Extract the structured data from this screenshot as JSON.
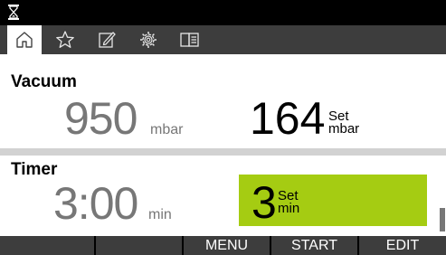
{
  "status_bar": {
    "icon": "hourglass-icon"
  },
  "tabs": [
    {
      "icon": "home-icon",
      "active": true
    },
    {
      "icon": "star-icon",
      "active": false
    },
    {
      "icon": "edit-icon",
      "active": false
    },
    {
      "icon": "gear-icon",
      "active": false
    },
    {
      "icon": "book-icon",
      "active": false
    }
  ],
  "vacuum": {
    "title": "Vacuum",
    "actual_value": "950",
    "actual_unit": "mbar",
    "set_value": "164",
    "set_label": "Set",
    "set_unit": "mbar"
  },
  "timer": {
    "title": "Timer",
    "actual_value": "3:00",
    "actual_unit": "min",
    "set_value": "3",
    "set_label": "Set",
    "set_unit": "min"
  },
  "softkeys": [
    "",
    "",
    "MENU",
    "START",
    "EDIT"
  ],
  "colors": {
    "highlight": "#a5cc12",
    "bar": "#3d3d3d",
    "value_gray": "#777777"
  }
}
